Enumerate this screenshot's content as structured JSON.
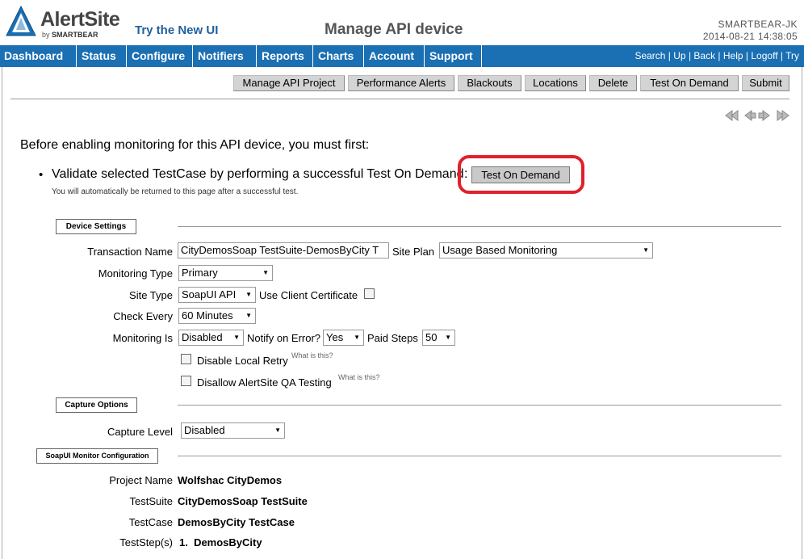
{
  "header": {
    "logo_name": "AlertSite",
    "logo_by": "by",
    "logo_brand": "SMARTBEAR",
    "try_new_ui": "Try the New UI",
    "page_title": "Manage API device",
    "user": "SMARTBEAR-JK",
    "datetime": "2014-08-21 14:38:05"
  },
  "nav": {
    "items": [
      "Dashboard",
      "Status",
      "Configure",
      "Notifiers",
      "Reports",
      "Charts",
      "Account",
      "Support"
    ],
    "links": [
      "Search",
      "Up",
      "Back",
      "Help",
      "Logoff",
      "Try"
    ],
    "color": "#1b6fb3"
  },
  "toolbar": {
    "buttons": [
      "Manage API Project",
      "Performance Alerts",
      "Blackouts",
      "Locations",
      "Delete",
      "Test On Demand",
      "Submit"
    ]
  },
  "intro": {
    "text": "Before enabling monitoring for this API device, you must first:",
    "bullet": "Validate selected TestCase by performing a successful Test On Demand",
    "colon": ":",
    "button": "Test On Demand",
    "note": "You will automatically be returned to this page after a successful test.",
    "highlight_color": "#e0202a"
  },
  "device_settings": {
    "title": "Device Settings",
    "transaction_name_label": "Transaction Name",
    "transaction_name_value": "CityDemosSoap TestSuite-DemosByCity T",
    "site_plan_label": "Site Plan",
    "site_plan_value": "Usage Based Monitoring",
    "monitoring_type_label": "Monitoring Type",
    "monitoring_type_value": "Primary",
    "site_type_label": "Site Type",
    "site_type_value": "SoapUI API",
    "client_cert_label": "Use Client Certificate",
    "check_every_label": "Check Every",
    "check_every_value": "60 Minutes",
    "monitoring_is_label": "Monitoring Is",
    "monitoring_is_value": "Disabled",
    "notify_label": "Notify on Error?",
    "notify_value": "Yes",
    "paid_steps_label": "Paid Steps",
    "paid_steps_value": "50",
    "disable_retry_label": "Disable Local Retry",
    "disallow_qa_label": "Disallow AlertSite QA Testing",
    "what_is_this": "What is this?"
  },
  "capture_options": {
    "title": "Capture Options",
    "capture_level_label": "Capture Level",
    "capture_level_value": "Disabled"
  },
  "soapui": {
    "title": "SoapUI Monitor Configuration",
    "project_name_label": "Project Name",
    "project_name_value": "Wolfshac CityDemos",
    "testsuite_label": "TestSuite",
    "testsuite_value": "CityDemosSoap TestSuite",
    "testcase_label": "TestCase",
    "testcase_value": "DemosByCity TestCase",
    "teststeps_label": "TestStep(s)",
    "teststep_value": "1.  DemosByCity"
  }
}
